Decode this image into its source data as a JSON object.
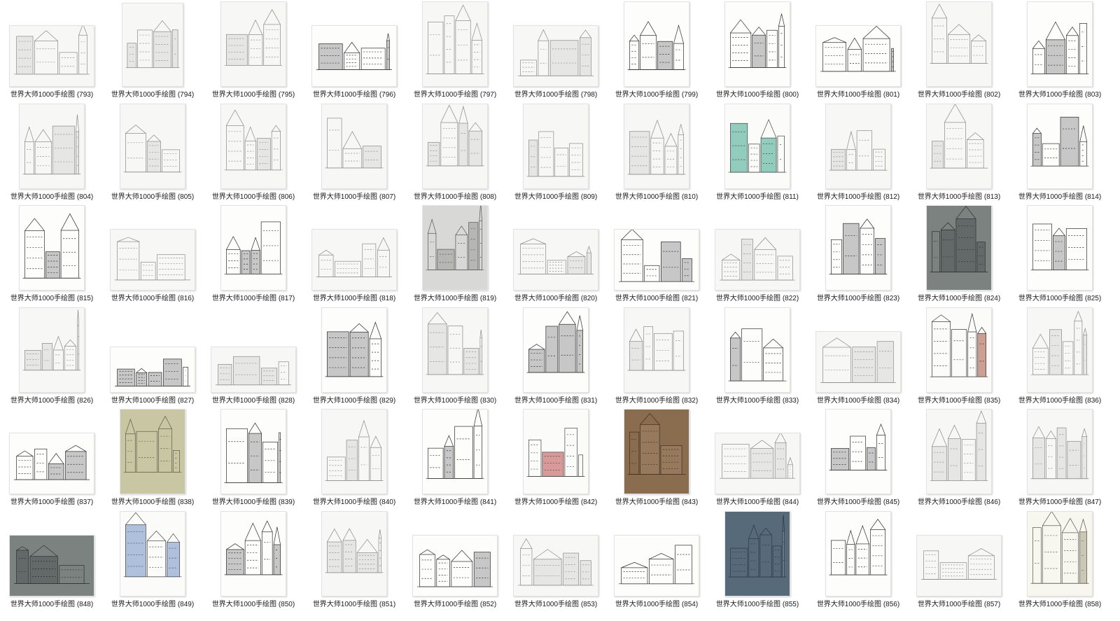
{
  "window": {
    "view": "large-icons"
  },
  "files": [
    {
      "name": "世界大师1000手绘图 (793)",
      "shape": "wide",
      "tone": "pencil"
    },
    {
      "name": "世界大师1000手绘图 (794)",
      "shape": "square",
      "tone": "pencil"
    },
    {
      "name": "世界大师1000手绘图 (795)",
      "shape": "tall",
      "tone": "pencil"
    },
    {
      "name": "世界大师1000手绘图 (796)",
      "shape": "wide",
      "tone": "ink"
    },
    {
      "name": "世界大师1000手绘图 (797)",
      "shape": "tall",
      "tone": "pencil"
    },
    {
      "name": "世界大师1000手绘图 (798)",
      "shape": "wide",
      "tone": "pencil"
    },
    {
      "name": "世界大师1000手绘图 (799)",
      "shape": "tall",
      "tone": "ink"
    },
    {
      "name": "世界大师1000手绘图 (800)",
      "shape": "tall",
      "tone": "ink"
    },
    {
      "name": "世界大师1000手绘图 (801)",
      "shape": "wide",
      "tone": "ink"
    },
    {
      "name": "世界大师1000手绘图 (802)",
      "shape": "tall",
      "tone": "pencil"
    },
    {
      "name": "世界大师1000手绘图 (803)",
      "shape": "tall",
      "tone": "ink"
    },
    {
      "name": "世界大师1000手绘图 (804)",
      "shape": "tall",
      "tone": "pencil"
    },
    {
      "name": "世界大师1000手绘图 (805)",
      "shape": "tall",
      "tone": "pencil"
    },
    {
      "name": "世界大师1000手绘图 (806)",
      "shape": "tall",
      "tone": "pencil"
    },
    {
      "name": "世界大师1000手绘图 (807)",
      "shape": "tall",
      "tone": "pencil"
    },
    {
      "name": "世界大师1000手绘图 (808)",
      "shape": "tall",
      "tone": "pencil"
    },
    {
      "name": "世界大师1000手绘图 (809)",
      "shape": "tall",
      "tone": "pencil"
    },
    {
      "name": "世界大师1000手绘图 (810)",
      "shape": "tall",
      "tone": "pencil"
    },
    {
      "name": "世界大师1000手绘图 (811)",
      "shape": "tall",
      "tone": "color-green"
    },
    {
      "name": "世界大师1000手绘图 (812)",
      "shape": "tall",
      "tone": "pencil"
    },
    {
      "name": "世界大师1000手绘图 (813)",
      "shape": "tall",
      "tone": "pencil"
    },
    {
      "name": "世界大师1000手绘图 (814)",
      "shape": "tall",
      "tone": "ink"
    },
    {
      "name": "世界大师1000手绘图 (815)",
      "shape": "tall",
      "tone": "ink"
    },
    {
      "name": "世界大师1000手绘图 (816)",
      "shape": "wide",
      "tone": "pencil"
    },
    {
      "name": "世界大师1000手绘图 (817)",
      "shape": "tall",
      "tone": "ink"
    },
    {
      "name": "世界大师1000手绘图 (818)",
      "shape": "wide",
      "tone": "pencil"
    },
    {
      "name": "世界大师1000手绘图 (819)",
      "shape": "tall",
      "tone": "gray"
    },
    {
      "name": "世界大师1000手绘图 (820)",
      "shape": "wide",
      "tone": "pencil"
    },
    {
      "name": "世界大师1000手绘图 (821)",
      "shape": "wide",
      "tone": "ink"
    },
    {
      "name": "世界大师1000手绘图 (822)",
      "shape": "wide",
      "tone": "pencil"
    },
    {
      "name": "世界大师1000手绘图 (823)",
      "shape": "tall",
      "tone": "ink"
    },
    {
      "name": "世界大师1000手绘图 (824)",
      "shape": "tall",
      "tone": "dark"
    },
    {
      "name": "世界大师1000手绘图 (825)",
      "shape": "tall",
      "tone": "ink"
    },
    {
      "name": "世界大师1000手绘图 (826)",
      "shape": "tall",
      "tone": "pencil"
    },
    {
      "name": "世界大师1000手绘图 (827)",
      "shape": "wide-short",
      "tone": "ink"
    },
    {
      "name": "世界大师1000手绘图 (828)",
      "shape": "wide-short",
      "tone": "pencil"
    },
    {
      "name": "世界大师1000手绘图 (829)",
      "shape": "tall",
      "tone": "ink"
    },
    {
      "name": "世界大师1000手绘图 (830)",
      "shape": "tall",
      "tone": "pencil"
    },
    {
      "name": "世界大师1000手绘图 (831)",
      "shape": "tall",
      "tone": "ink"
    },
    {
      "name": "世界大师1000手绘图 (832)",
      "shape": "tall",
      "tone": "pencil"
    },
    {
      "name": "世界大师1000手绘图 (833)",
      "shape": "tall",
      "tone": "ink"
    },
    {
      "name": "世界大师1000手绘图 (834)",
      "shape": "wide",
      "tone": "pencil"
    },
    {
      "name": "世界大师1000手绘图 (835)",
      "shape": "tall",
      "tone": "color-red"
    },
    {
      "name": "世界大师1000手绘图 (836)",
      "shape": "tall",
      "tone": "pencil"
    },
    {
      "name": "世界大师1000手绘图 (837)",
      "shape": "wide",
      "tone": "ink"
    },
    {
      "name": "世界大师1000手绘图 (838)",
      "shape": "tall",
      "tone": "color-sage"
    },
    {
      "name": "世界大师1000手绘图 (839)",
      "shape": "tall",
      "tone": "ink"
    },
    {
      "name": "世界大师1000手绘图 (840)",
      "shape": "tall",
      "tone": "pencil"
    },
    {
      "name": "世界大师1000手绘图 (841)",
      "shape": "tall",
      "tone": "ink"
    },
    {
      "name": "世界大师1000手绘图 (842)",
      "shape": "tall",
      "tone": "color-brick"
    },
    {
      "name": "世界大师1000手绘图 (843)",
      "shape": "tall",
      "tone": "color-brown"
    },
    {
      "name": "世界大师1000手绘图 (844)",
      "shape": "wide",
      "tone": "pencil"
    },
    {
      "name": "世界大师1000手绘图 (845)",
      "shape": "tall",
      "tone": "ink"
    },
    {
      "name": "世界大师1000手绘图 (846)",
      "shape": "tall",
      "tone": "pencil"
    },
    {
      "name": "世界大师1000手绘图 (847)",
      "shape": "tall",
      "tone": "pencil"
    },
    {
      "name": "世界大师1000手绘图 (848)",
      "shape": "wide",
      "tone": "dark"
    },
    {
      "name": "世界大师1000手绘图 (849)",
      "shape": "tall",
      "tone": "color-blue"
    },
    {
      "name": "世界大师1000手绘图 (850)",
      "shape": "tall",
      "tone": "ink"
    },
    {
      "name": "世界大师1000手绘图 (851)",
      "shape": "tall",
      "tone": "pencil"
    },
    {
      "name": "世界大师1000手绘图 (852)",
      "shape": "wide",
      "tone": "ink"
    },
    {
      "name": "世界大师1000手绘图 (853)",
      "shape": "wide",
      "tone": "pencil"
    },
    {
      "name": "世界大师1000手绘图 (854)",
      "shape": "wide",
      "tone": "ink"
    },
    {
      "name": "世界大师1000手绘图 (855)",
      "shape": "tall",
      "tone": "color-slate"
    },
    {
      "name": "世界大师1000手绘图 (856)",
      "shape": "tall",
      "tone": "ink"
    },
    {
      "name": "世界大师1000手绘图 (857)",
      "shape": "wide",
      "tone": "pencil"
    },
    {
      "name": "世界大师1000手绘图 (858)",
      "shape": "tall",
      "tone": "color-olive"
    }
  ],
  "tones": {
    "pencil": {
      "bg": "#f7f7f5",
      "stroke": "#8a8a8a",
      "fill": "#d9d9d6"
    },
    "ink": {
      "bg": "#fdfdfc",
      "stroke": "#2b2b2b",
      "fill": "#9b9b9b"
    },
    "gray": {
      "bg": "#d8d8d6",
      "stroke": "#555555",
      "fill": "#9a9a98"
    },
    "dark": {
      "bg": "#7b8280",
      "stroke": "#2a2e2d",
      "fill": "#4f5553"
    },
    "color-green": {
      "bg": "#fbfbf9",
      "stroke": "#444444",
      "fill": "#3aa58a"
    },
    "color-red": {
      "bg": "#fbfbf9",
      "stroke": "#333333",
      "fill": "#a5543f"
    },
    "color-sage": {
      "bg": "#c9c7a3",
      "stroke": "#5d5a48",
      "fill": "#8c8a6e"
    },
    "color-brick": {
      "bg": "#fbfbf9",
      "stroke": "#444444",
      "fill": "#b94a48"
    },
    "color-brown": {
      "bg": "#8a6c4e",
      "stroke": "#3c2f22",
      "fill": "#a3856a"
    },
    "color-blue": {
      "bg": "#fbfbf9",
      "stroke": "#444444",
      "fill": "#6f8fc4"
    },
    "color-slate": {
      "bg": "#566a79",
      "stroke": "#2a3742",
      "fill": "#7b8d9a"
    },
    "color-olive": {
      "bg": "#f7f7f0",
      "stroke": "#555548",
      "fill": "#a5a385"
    }
  }
}
